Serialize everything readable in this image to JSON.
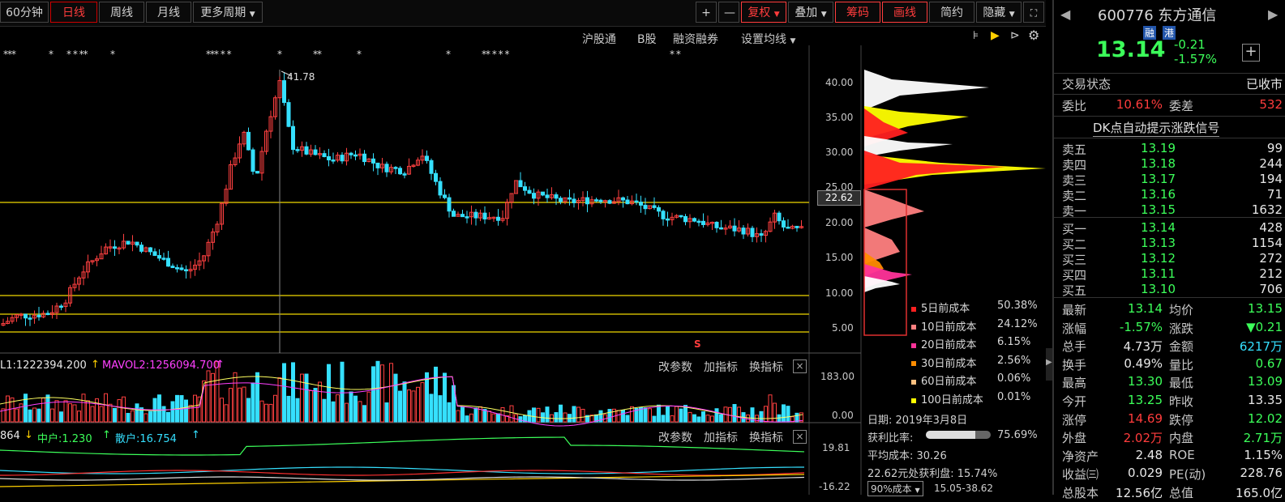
{
  "toolbar": {
    "left_tabs": [
      "60分钟",
      "日线",
      "周线",
      "月线",
      "更多周期"
    ],
    "active_tab": "日线",
    "plus": "+",
    "minus": "—",
    "fuquan": "复权",
    "diejia": "叠加",
    "chouma": "筹码",
    "huaxian": "画线",
    "jianyue": "简约",
    "yincang": "隐藏"
  },
  "subbar": {
    "hugutong": "沪股通",
    "bgu": "B股",
    "rongzi": "融资融券",
    "shezhi": "设置均线"
  },
  "main_chart": {
    "price_axis": [
      "40.00",
      "35.00",
      "30.00",
      "25.00",
      "20.00",
      "15.00",
      "10.00",
      "5.00"
    ],
    "crosshair_price": "22.62",
    "peak_label": "41.78",
    "dividend_marker": "S"
  },
  "chip_legend": [
    {
      "label": "5日前成本",
      "pct": "50.38%",
      "color": "#ff2020"
    },
    {
      "label": "10日前成本",
      "pct": "24.12%",
      "color": "#ff8080"
    },
    {
      "label": "20日前成本",
      "pct": "6.15%",
      "color": "#ff3399"
    },
    {
      "label": "30日前成本",
      "pct": "2.56%",
      "color": "#ff8c00"
    },
    {
      "label": "60日前成本",
      "pct": "0.06%",
      "color": "#ffc080"
    },
    {
      "label": "100日前成本",
      "pct": "0.01%",
      "color": "#ffff00"
    }
  ],
  "chip_info": {
    "date": "日期: 2019年3月8日",
    "profit_label": "获利比率:",
    "profit_value": "75.69%",
    "avg_cost": "平均成本: 30.26",
    "profit_at": "22.62元处获利盘: 15.74%",
    "cost_range_btn": "90%成本",
    "cost_range": "15.05-38.62"
  },
  "volume_panel": {
    "mavol1": "L1:1222394.200",
    "mavol2": "MAVOL2:1256094.700",
    "axis_top": "183.00",
    "axis_bottom": "0.00",
    "btn1": "改参数",
    "btn2": "加指标",
    "btn3": "换指标",
    "close": "×"
  },
  "indicator_panel": {
    "v1": "864",
    "mid_label": "中户:1.230",
    "san_label": "散户:16.754",
    "axis_top": "19.81",
    "axis_bottom": "-16.22",
    "btn1": "改参数",
    "btn2": "加指标",
    "btn3": "换指标",
    "close": "×"
  },
  "stock": {
    "code_name": "600776 东方通信",
    "tag1": "融",
    "tag2": "港",
    "price": "13.14",
    "change": "-0.21",
    "change_pct": "-1.57%",
    "add": "+"
  },
  "status": {
    "label": "交易状态",
    "value": "已收市"
  },
  "weibi": {
    "label": "委比",
    "value": "10.61%",
    "label2": "委差",
    "value2": "532"
  },
  "signal_title": "DK点自动提示涨跌信号",
  "sells": [
    {
      "label": "卖五",
      "price": "13.19",
      "vol": "99"
    },
    {
      "label": "卖四",
      "price": "13.18",
      "vol": "244"
    },
    {
      "label": "卖三",
      "price": "13.17",
      "vol": "194"
    },
    {
      "label": "卖二",
      "price": "13.16",
      "vol": "71"
    },
    {
      "label": "卖一",
      "price": "13.15",
      "vol": "1632"
    }
  ],
  "buys": [
    {
      "label": "买一",
      "price": "13.14",
      "vol": "428"
    },
    {
      "label": "买二",
      "price": "13.13",
      "vol": "1154"
    },
    {
      "label": "买三",
      "price": "13.12",
      "vol": "272"
    },
    {
      "label": "买四",
      "price": "13.11",
      "vol": "212"
    },
    {
      "label": "买五",
      "price": "13.10",
      "vol": "706"
    }
  ],
  "stats": [
    {
      "l1": "最新",
      "v1": "13.14",
      "c1": "g",
      "l2": "均价",
      "v2": "13.15",
      "c2": "g"
    },
    {
      "l1": "涨幅",
      "v1": "-1.57%",
      "c1": "g",
      "l2": "涨跌",
      "v2": "▼0.21",
      "c2": "g"
    },
    {
      "l1": "总手",
      "v1": "4.73万",
      "c1": "w",
      "l2": "金额",
      "v2": "6217万",
      "c2": "c"
    },
    {
      "l1": "换手",
      "v1": "0.49%",
      "c1": "w",
      "l2": "量比",
      "v2": "0.67",
      "c2": "g"
    },
    {
      "l1": "最高",
      "v1": "13.30",
      "c1": "g",
      "l2": "最低",
      "v2": "13.09",
      "c2": "g"
    },
    {
      "l1": "今开",
      "v1": "13.25",
      "c1": "g",
      "l2": "昨收",
      "v2": "13.35",
      "c2": "w"
    },
    {
      "l1": "涨停",
      "v1": "14.69",
      "c1": "r",
      "l2": "跌停",
      "v2": "12.02",
      "c2": "g"
    },
    {
      "l1": "外盘",
      "v1": "2.02万",
      "c1": "r",
      "l2": "内盘",
      "v2": "2.71万",
      "c2": "g"
    },
    {
      "l1": "净资产",
      "v1": "2.48",
      "c1": "w",
      "l2": "ROE",
      "v2": "1.15%",
      "c2": "w"
    },
    {
      "l1": "收益㈢",
      "v1": "0.029",
      "c1": "w",
      "l2": "PE(动)",
      "v2": "228.76",
      "c2": "w"
    },
    {
      "l1": "总股本",
      "v1": "12.56亿",
      "c1": "w",
      "l2": "总值",
      "v2": "165.0亿",
      "c2": "w"
    }
  ]
}
